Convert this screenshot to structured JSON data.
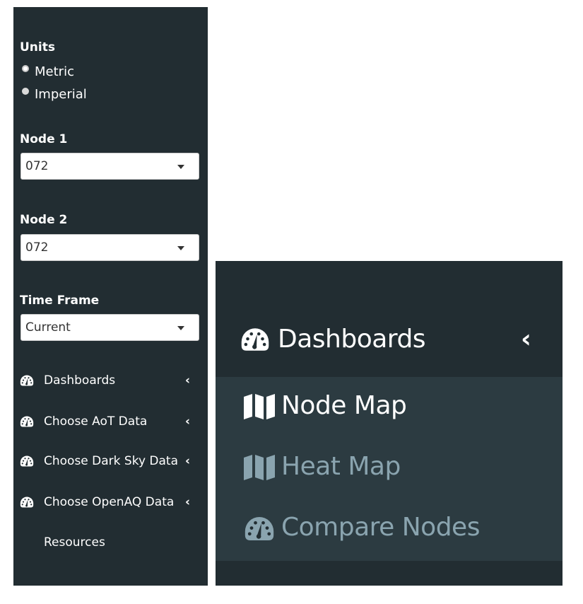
{
  "sidebar": {
    "units": {
      "label": "Units",
      "options": [
        "Metric",
        "Imperial"
      ],
      "selected": "Metric"
    },
    "node1": {
      "label": "Node 1",
      "value": "072"
    },
    "node2": {
      "label": "Node 2",
      "value": "072"
    },
    "time_frame": {
      "label": "Time Frame",
      "value": "Current"
    },
    "menu": [
      {
        "label": "Dashboards",
        "icon": "dashboard-gauge-icon",
        "expand_icon": "chevron-left-icon"
      },
      {
        "label": "Choose AoT Data",
        "icon": "dashboard-gauge-icon",
        "expand_icon": "chevron-left-icon"
      },
      {
        "label": "Choose Dark Sky Data",
        "icon": "dashboard-gauge-icon",
        "expand_icon": "chevron-left-icon"
      },
      {
        "label": "Choose OpenAQ Data",
        "icon": "dashboard-gauge-icon",
        "expand_icon": "chevron-left-icon"
      },
      {
        "label": "Resources"
      }
    ],
    "chevron": "‹"
  },
  "zoom_panel": {
    "header": {
      "label": "Dashboards",
      "icon": "dashboard-gauge-icon",
      "chevron": "‹"
    },
    "items": [
      {
        "label": "Node Map",
        "icon": "map-icon",
        "state": "active"
      },
      {
        "label": "Heat Map",
        "icon": "map-icon",
        "state": "inactive"
      },
      {
        "label": "Compare Nodes",
        "icon": "dashboard-gauge-icon",
        "state": "inactive"
      }
    ]
  },
  "colors": {
    "sidebar_bg": "#222d32",
    "submenu_bg": "#2c3b41",
    "text": "#ffffff",
    "muted_text": "#8aa4af"
  }
}
